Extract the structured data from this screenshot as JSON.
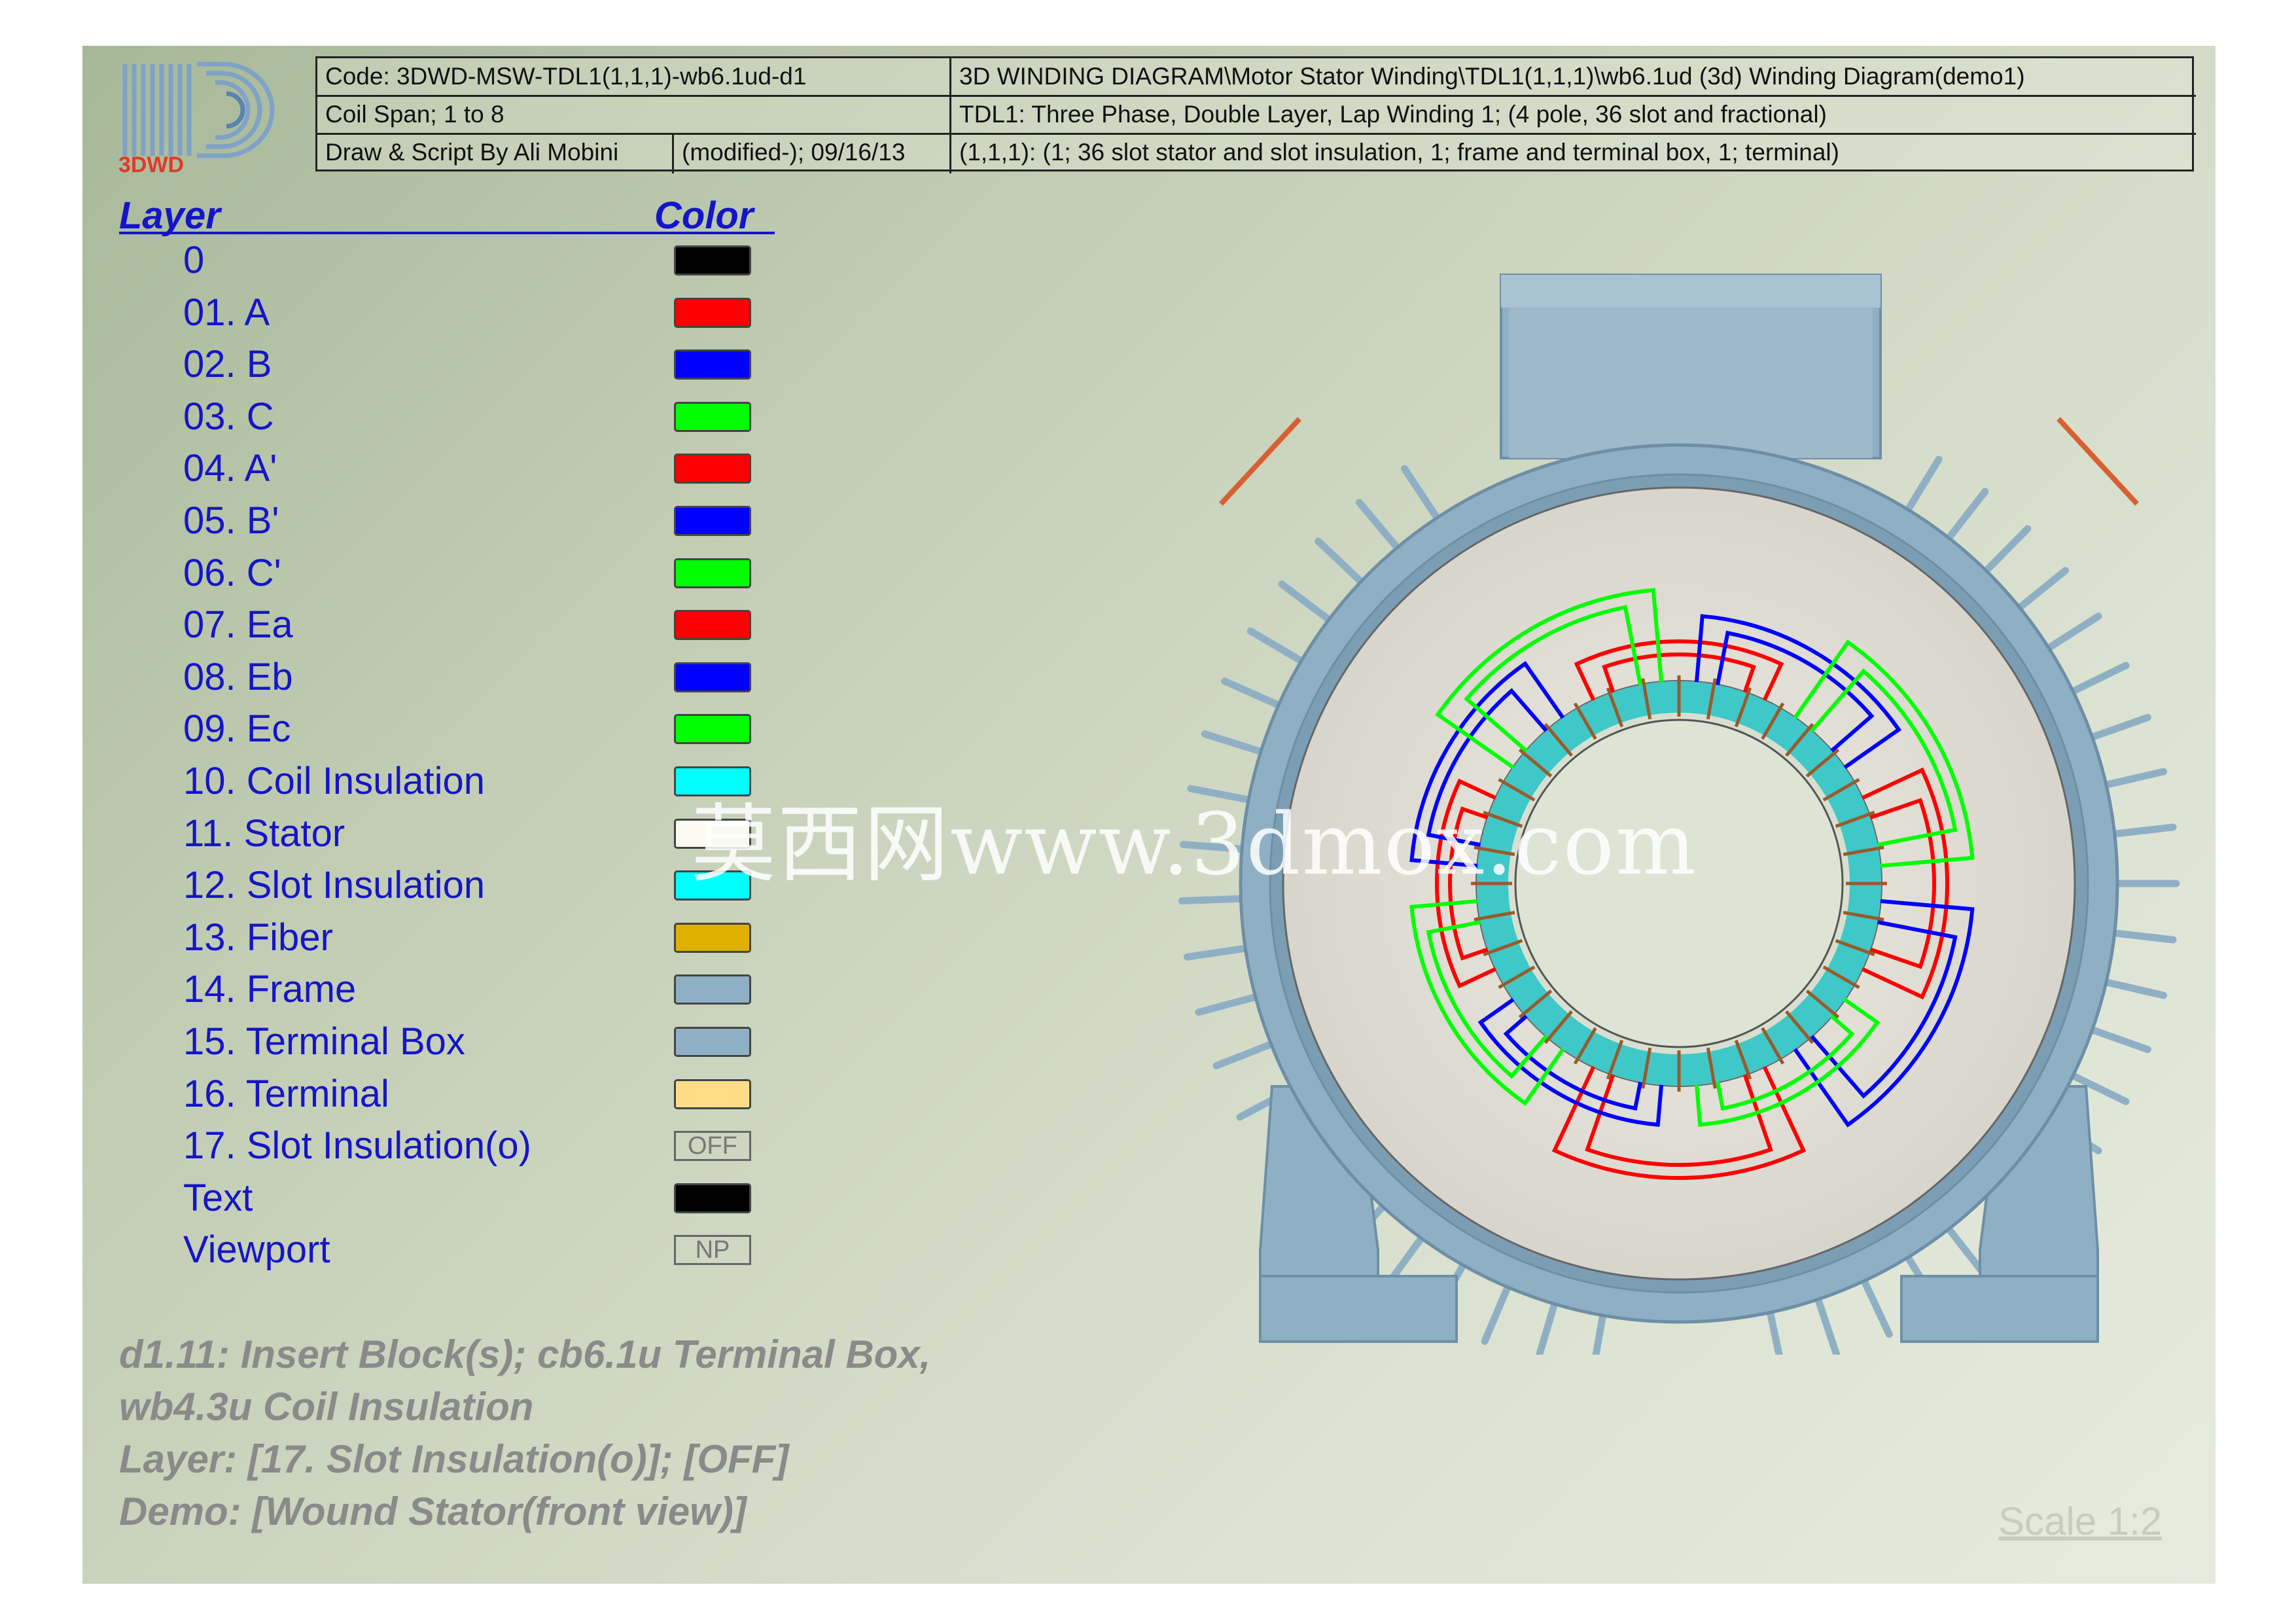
{
  "title_block": {
    "code": "Code: 3DWD-MSW-TDL1(1,1,1)-wb6.1ud-d1",
    "path": "3D WINDING DIAGRAM\\Motor Stator Winding\\TDL1(1,1,1)\\wb6.1ud (3d) Winding Diagram(demo1)",
    "coil_span": "Coil Span; 1 to 8",
    "description": "TDL1: Three Phase, Double Layer, Lap Winding 1; (4 pole, 36 slot and fractional)",
    "author": "Draw & Script By Ali Mobini",
    "modified": "(modified-); 09/16/13",
    "parts": "(1,1,1): (1; 36 slot stator and slot insulation, 1; frame and terminal box, 1; terminal)"
  },
  "logo": {
    "text": "3DWD"
  },
  "legend": {
    "layer_header": "Layer",
    "color_header": "Color",
    "items": [
      {
        "label": "0",
        "color": "#000000"
      },
      {
        "label": "01. A",
        "color": "#ff0000"
      },
      {
        "label": "02. B",
        "color": "#0000ff"
      },
      {
        "label": "03. C",
        "color": "#00ff00"
      },
      {
        "label": "04. A'",
        "color": "#ff0000"
      },
      {
        "label": "05. B'",
        "color": "#0000ff"
      },
      {
        "label": "06. C'",
        "color": "#00ff00"
      },
      {
        "label": "07. Ea",
        "color": "#ff0000"
      },
      {
        "label": "08. Eb",
        "color": "#0000ff"
      },
      {
        "label": "09. Ec",
        "color": "#00ff00"
      },
      {
        "label": "10. Coil Insulation",
        "color": "#00ffff"
      },
      {
        "label": "11. Stator",
        "color": "#fafaf0"
      },
      {
        "label": "12. Slot Insulation",
        "color": "#00ffff"
      },
      {
        "label": "13. Fiber",
        "color": "#e0b000"
      },
      {
        "label": "14. Frame",
        "color": "#8fb0c4"
      },
      {
        "label": "15. Terminal Box",
        "color": "#8fb0c4"
      },
      {
        "label": "16. Terminal",
        "color": "#ffdd88"
      },
      {
        "label": "17. Slot Insulation(o)",
        "swatch_text": "OFF"
      },
      {
        "label": "Text",
        "color": "#000000"
      },
      {
        "label": "Viewport",
        "swatch_text": "NP"
      }
    ]
  },
  "notes": [
    "d1.11: Insert Block(s); cb6.1u Terminal Box,",
    "wb4.3u Coil Insulation",
    "Layer: [17. Slot Insulation(o)]; [OFF]",
    "Demo: [Wound Stator(front view)]"
  ],
  "scale": "Scale 1:2",
  "watermark": "莫西网www.3dmox.com",
  "colors": {
    "phase_a": "#ff0000",
    "phase_b": "#0000ff",
    "phase_c": "#00ff00",
    "frame": "#8fb0c4",
    "stator": "#e4e2d8",
    "coil_insulation": "#3fc8c8",
    "legend_text": "#1515c8"
  }
}
